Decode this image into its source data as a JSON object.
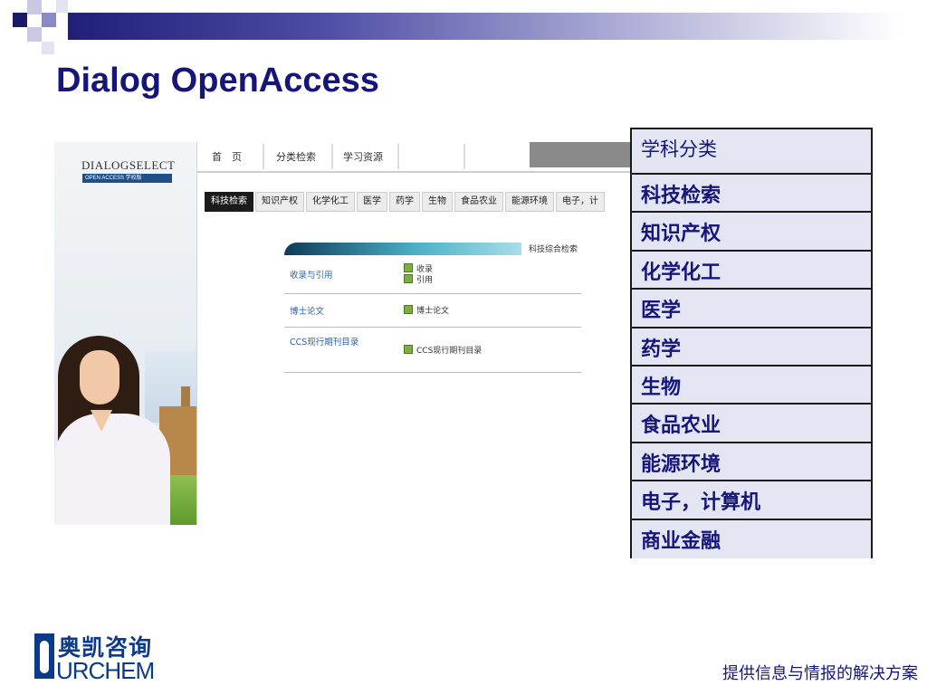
{
  "slide": {
    "title": "Dialog OpenAccess",
    "tagline": "提供信息与情报的解决方案"
  },
  "logo": {
    "cn": "奥凯咨询",
    "en": "URCHEM"
  },
  "screenshot": {
    "brand": "DIALOGSELECT",
    "brand_sub": "OPEN ACCESS 学校版",
    "nav_top": [
      "首　页",
      "分类检索",
      "学习资源"
    ],
    "nav_tabs": [
      "科技检索",
      "知识产权",
      "化学化工",
      "医学",
      "药学",
      "生物",
      "食品农业",
      "能源环境",
      "电子，计"
    ],
    "banner_label": "科技综合检索",
    "rows": [
      {
        "left": "收录与引用",
        "right": [
          "收录",
          "引用"
        ]
      },
      {
        "left": "博士论文",
        "right": [
          "博士论文"
        ]
      },
      {
        "left": "CCS现行期刊目录",
        "right": [
          "CCS现行期刊目录"
        ]
      }
    ]
  },
  "subjects": {
    "header": "学科分类",
    "items": [
      "科技检索",
      "知识产权",
      "化学化工",
      "医学",
      "药学",
      "生物",
      "食品农业",
      "能源环境",
      "电子，计算机",
      "商业金融"
    ]
  }
}
